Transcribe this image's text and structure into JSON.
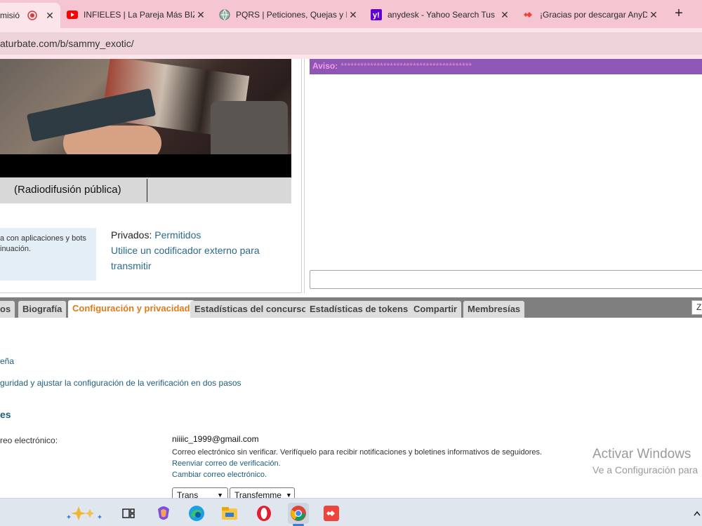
{
  "browser": {
    "tabs": [
      {
        "title": "misió",
        "active": true,
        "icon": "record-icon"
      },
      {
        "title": "INFIELES | La Pareja Más BIZA",
        "icon": "youtube-icon"
      },
      {
        "title": "PQRS | Peticiones, Quejas y R",
        "icon": "globe-icon"
      },
      {
        "title": "anydesk - Yahoo Search Tus",
        "icon": "yahoo-icon"
      },
      {
        "title": "¡Gracias por descargar AnyD",
        "icon": "anydesk-icon"
      }
    ],
    "close_glyph": "✕",
    "new_tab_glyph": "+",
    "url": "aturbate.com/b/sammy_exotic/"
  },
  "broadcast": {
    "mode_label": "(Radiodifusión pública)",
    "info_line1": "a con aplicaciones y bots",
    "info_line2": "inuación.",
    "privados_label": "Privados:",
    "privados_value": "Permitidos",
    "encoder_link_line1": "Utilice un codificador externo para",
    "encoder_link_line2": "transmitir"
  },
  "chat": {
    "aviso_label": "Aviso:",
    "aviso_text": "****************************************"
  },
  "profile_tabs": [
    {
      "label": "os"
    },
    {
      "label": "Biografía"
    },
    {
      "label": "Configuración y privacidad",
      "active": true
    },
    {
      "label": "Estadísticas del concurso"
    },
    {
      "label": "Estadísticas de tokens"
    },
    {
      "label": "Compartir"
    },
    {
      "label": "Membresías"
    }
  ],
  "profile_tabs_right_label": "Z",
  "settings": {
    "link_password": "eña",
    "link_security": "guridad y ajustar la configuración de la verificación en dos pasos",
    "section_heading": "es",
    "email_label": "reo electrónico:",
    "email_value": "niiiic_1999@gmail.com",
    "email_note": "Correo electrónico sin verificar. Verifíquelo para recibir notificaciones y boletines informativos de seguidores.",
    "resend_link": "Reenviar correo de verificación.",
    "change_link": "Cambiar correo electrónico.",
    "select1": "Trans",
    "select2": "Transfemme"
  },
  "watermark": {
    "line1": "Activar Windows",
    "line2": "Ve a Configuración para"
  },
  "taskbar": {
    "icons": [
      "copilot-sparkle-icon",
      "task-view-icon",
      "copilot-icon",
      "edge-icon",
      "file-explorer-icon",
      "opera-icon",
      "chrome-icon",
      "anydesk-icon"
    ],
    "active": "chrome-icon"
  },
  "colors": {
    "tab_bar": "#f5c6d2",
    "active_tab": "#e07a18",
    "link": "#1f5f7a",
    "aviso_bg": "#8e56b5",
    "aviso_text": "#e58bd8"
  }
}
